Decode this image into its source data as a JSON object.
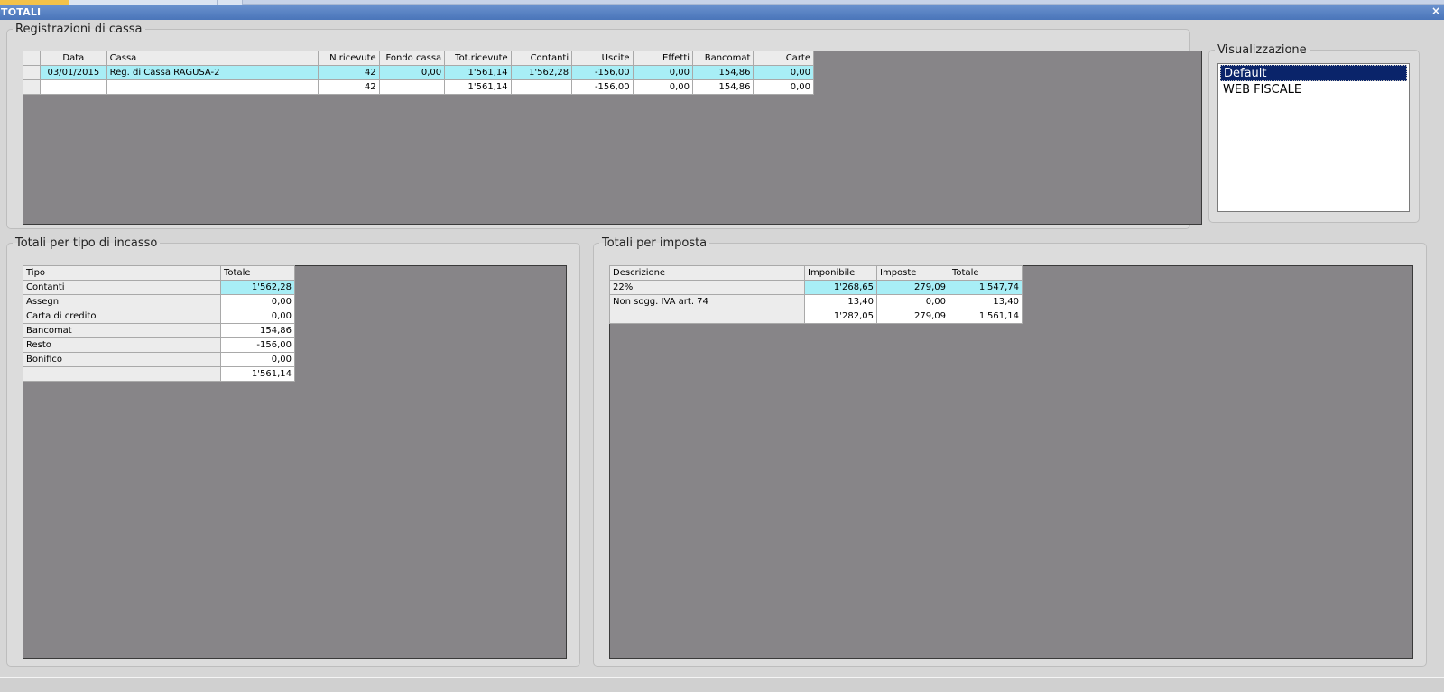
{
  "window": {
    "title": "TOTALI",
    "close_label": "×"
  },
  "registrazioni": {
    "legend": "Registrazioni di cassa",
    "columns": [
      "Data",
      "Cassa",
      "N.ricevute",
      "Fondo cassa",
      "Tot.ricevute",
      "Contanti",
      "Uscite",
      "Effetti",
      "Bancomat",
      "Carte"
    ],
    "rows": [
      [
        "03/01/2015",
        "Reg. di Cassa RAGUSA-2",
        "42",
        "0,00",
        "1'561,14",
        "1'562,28",
        "-156,00",
        "0,00",
        "154,86",
        "0,00"
      ]
    ],
    "totals": [
      "",
      "",
      "42",
      "",
      "1'561,14",
      "",
      "-156,00",
      "0,00",
      "154,86",
      "0,00"
    ]
  },
  "visualizzazione": {
    "legend": "Visualizzazione",
    "items": [
      "Default",
      "WEB FISCALE"
    ],
    "selected": "Default"
  },
  "tipo_incasso": {
    "legend": "Totali per tipo di incasso",
    "columns": [
      "Tipo",
      "Totale"
    ],
    "rows": [
      [
        "Contanti",
        "1'562,28"
      ],
      [
        "Assegni",
        "0,00"
      ],
      [
        "Carta di credito",
        "0,00"
      ],
      [
        "Bancomat",
        "154,86"
      ],
      [
        "Resto",
        "-156,00"
      ],
      [
        "Bonifico",
        "0,00"
      ]
    ],
    "total": "1'561,14"
  },
  "imposta": {
    "legend": "Totali per imposta",
    "columns": [
      "Descrizione",
      "Imponibile",
      "Imposte",
      "Totale"
    ],
    "rows": [
      [
        "22%",
        "1'268,65",
        "279,09",
        "1'547,74"
      ],
      [
        "Non sogg. IVA art. 74",
        "13,40",
        "0,00",
        "13,40"
      ]
    ],
    "totals": [
      "",
      "1'282,05",
      "279,09",
      "1'561,14"
    ]
  },
  "colors": {
    "highlight": "#a8eef6",
    "dark_area": "#878588",
    "title_bar": "#4a75b9",
    "selection": "#0a246a"
  }
}
